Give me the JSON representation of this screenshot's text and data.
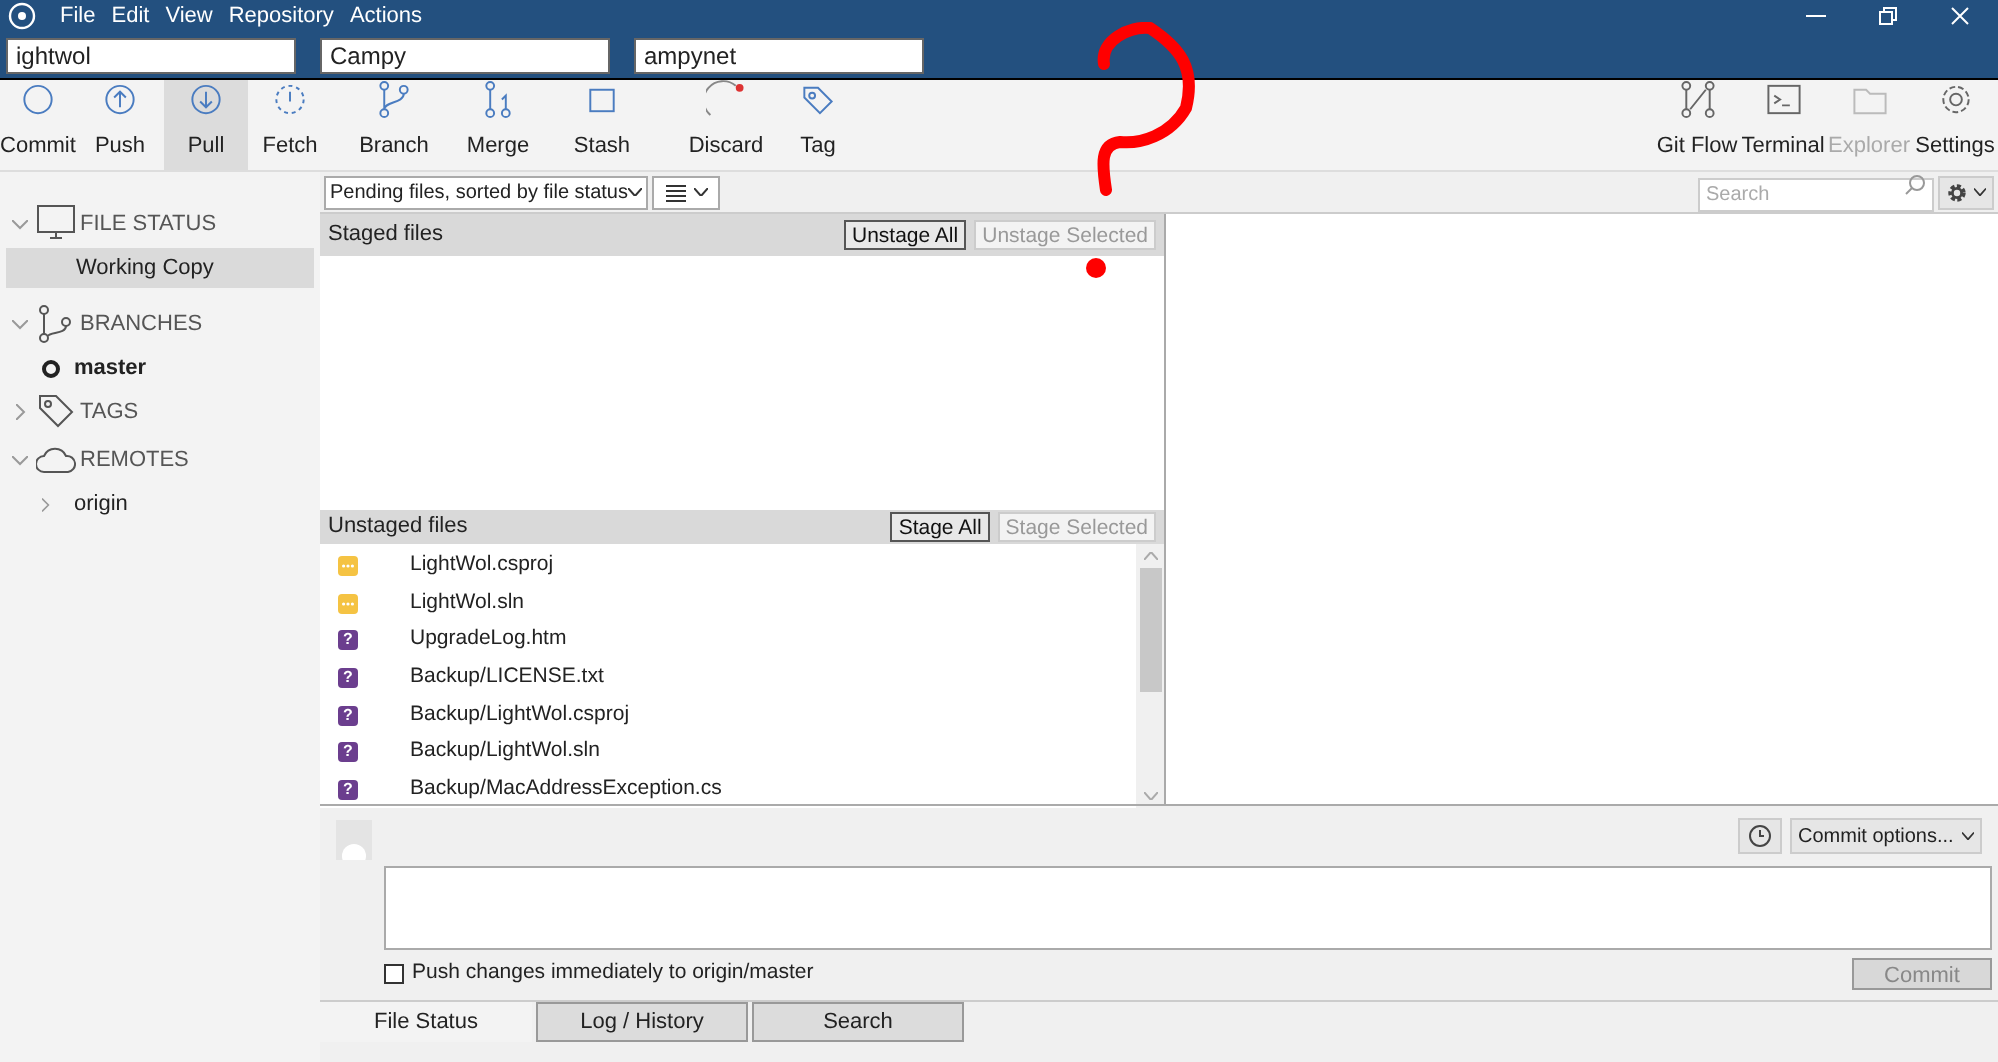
{
  "menu": [
    "File",
    "Edit",
    "View",
    "Repository",
    "Actions"
  ],
  "repo_tabs": [
    {
      "label": "ightwol"
    },
    {
      "label": "Campy"
    },
    {
      "label": "ampynet"
    }
  ],
  "toolbar": [
    {
      "kind": "commit",
      "label": "Commit",
      "selected": false,
      "disabled": false
    },
    {
      "kind": "push",
      "label": "Push",
      "selected": false,
      "disabled": false
    },
    {
      "kind": "pull",
      "label": "Pull",
      "selected": true,
      "disabled": false
    },
    {
      "kind": "fetch",
      "label": "Fetch",
      "selected": false,
      "disabled": false
    },
    {
      "kind": "branch",
      "label": "Branch",
      "selected": false,
      "disabled": false
    },
    {
      "kind": "merge",
      "label": "Merge",
      "selected": false,
      "disabled": false
    },
    {
      "kind": "stash",
      "label": "Stash",
      "selected": false,
      "disabled": false
    },
    {
      "kind": "discard",
      "label": "Discard",
      "selected": false,
      "disabled": false
    },
    {
      "kind": "tag",
      "label": "Tag",
      "selected": false,
      "disabled": false
    }
  ],
  "toolbar_right": [
    {
      "kind": "gitflow",
      "label": "Git Flow",
      "disabled": false
    },
    {
      "kind": "terminal",
      "label": "Terminal",
      "disabled": false
    },
    {
      "kind": "explorer",
      "label": "Explorer",
      "disabled": true
    },
    {
      "kind": "settings",
      "label": "Settings",
      "disabled": false
    }
  ],
  "sidebar": [
    {
      "kind": "status",
      "label": "FILE STATUS",
      "expanded": true,
      "children": [
        {
          "label": "Working Copy",
          "selected": true,
          "current": false
        }
      ]
    },
    {
      "kind": "branches",
      "label": "BRANCHES",
      "expanded": true,
      "children": [
        {
          "label": "master",
          "selected": false,
          "current": true
        }
      ]
    },
    {
      "kind": "tags",
      "label": "TAGS",
      "expanded": false
    },
    {
      "kind": "remotes",
      "label": "REMOTES",
      "expanded": true,
      "children": [
        {
          "label": "origin",
          "selected": false,
          "current": false
        }
      ]
    }
  ],
  "filter": {
    "value": "Pending files, sorted by file status"
  },
  "search": {
    "placeholder": "Search"
  },
  "staged": {
    "title": "Staged files",
    "buttons": [
      {
        "label": "Unstage All",
        "disabled": false
      },
      {
        "label": "Unstage Selected",
        "disabled": true
      }
    ]
  },
  "unstaged": {
    "title": "Unstaged files",
    "buttons": [
      {
        "label": "Stage All",
        "disabled": false
      },
      {
        "label": "Stage Selected",
        "disabled": true
      }
    ],
    "files": [
      {
        "kind": "modified",
        "name": "LightWol.csproj"
      },
      {
        "kind": "modified",
        "name": "LightWol.sln"
      },
      {
        "kind": "untracked",
        "badge": "?",
        "name": "UpgradeLog.htm"
      },
      {
        "kind": "untracked",
        "badge": "?",
        "name": "Backup/LICENSE.txt"
      },
      {
        "kind": "untracked",
        "badge": "?",
        "name": "Backup/LightWol.csproj"
      },
      {
        "kind": "untracked",
        "badge": "?",
        "name": "Backup/LightWol.sln"
      },
      {
        "kind": "untracked",
        "badge": "?",
        "name": "Backup/MacAddressException.cs"
      }
    ]
  },
  "commit": {
    "options": "Commit options...",
    "push_label": "Push changes immediately to origin/master",
    "push_checked": false,
    "button": "Commit",
    "button_disabled": true
  },
  "bottom_tabs": [
    {
      "label": "File Status",
      "selected": true
    },
    {
      "label": "Log / History",
      "selected": false
    },
    {
      "label": "Search",
      "selected": false
    }
  ]
}
